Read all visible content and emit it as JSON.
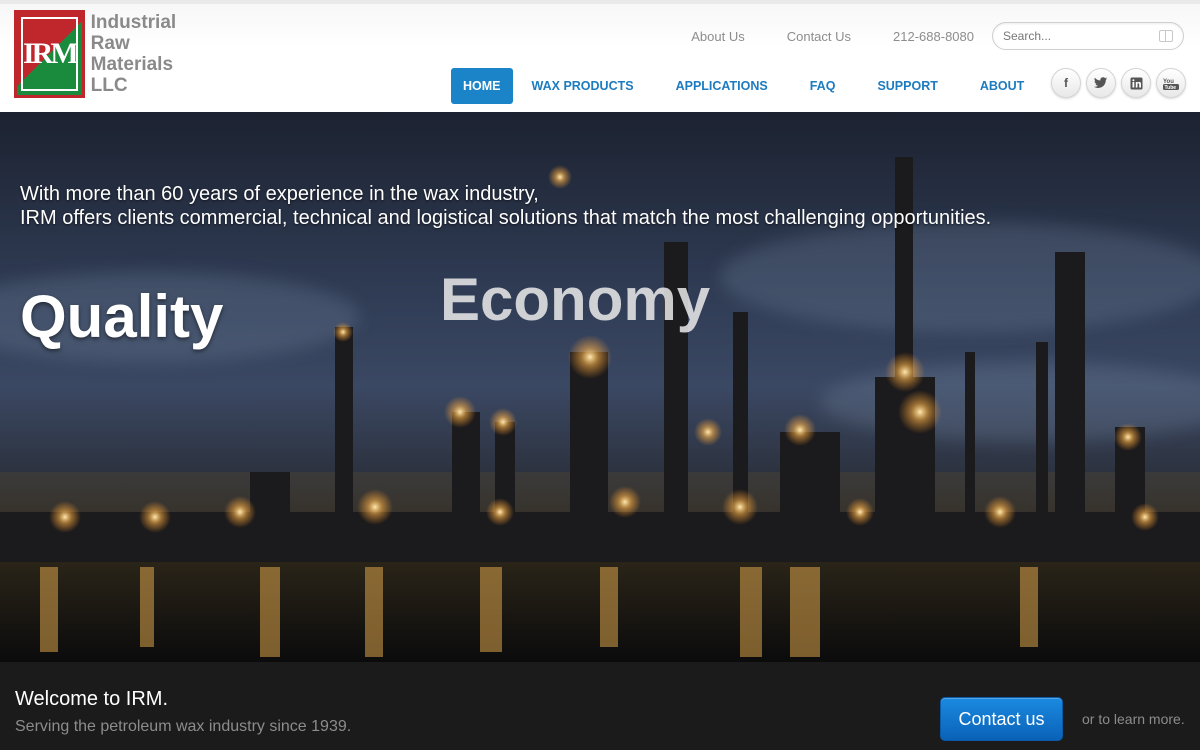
{
  "logo": {
    "mark": "IRM",
    "lines": [
      "Industrial",
      "Raw",
      "Materials",
      "LLC"
    ]
  },
  "utility": {
    "about": "About Us",
    "contact": "Contact Us",
    "phone": "212-688-8080",
    "search_placeholder": "Search..."
  },
  "nav": {
    "items": [
      "HOME",
      "WAX PRODUCTS",
      "APPLICATIONS",
      "FAQ",
      "SUPPORT",
      "ABOUT"
    ],
    "active": "HOME"
  },
  "social": {
    "facebook": "f",
    "twitter": "t",
    "linkedin": "in",
    "youtube": "You"
  },
  "hero": {
    "line1": "With more than 60 years of experience in the wax industry,",
    "line2": "IRM offers clients commercial, technical and logistical solutions that match the most challenging opportunities.",
    "word1": "Quality",
    "word2": "Economy"
  },
  "footer": {
    "welcome": "Welcome to IRM.",
    "tagline": "Serving the petroleum wax industry since 1939.",
    "contact_button": "Contact us",
    "learn_more": "or to learn more."
  },
  "colors": {
    "accent": "#1b84c8",
    "brand_red": "#c0272d",
    "brand_green": "#1a8b3c"
  }
}
